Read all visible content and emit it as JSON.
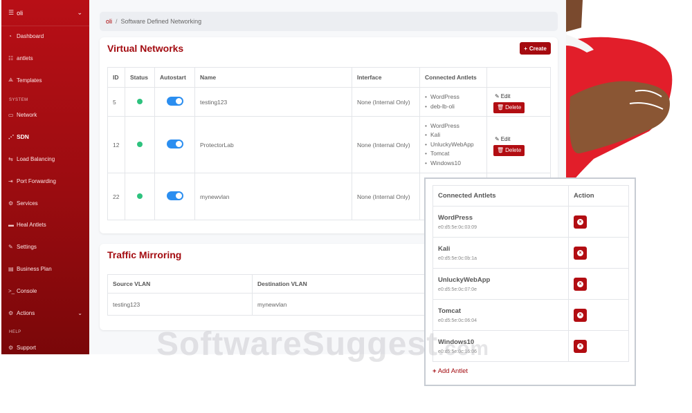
{
  "sidebar": {
    "user": "oli",
    "sections": {
      "system": "SYSTEM",
      "help": "HELP"
    },
    "items": [
      {
        "label": "Dashboard",
        "icon": "dashboard-icon"
      },
      {
        "label": "antlets",
        "icon": "list-icon"
      },
      {
        "label": "Templates",
        "icon": "templates-icon"
      },
      {
        "label": "Network",
        "icon": "network-icon"
      },
      {
        "label": "SDN",
        "icon": "sdn-icon",
        "active": true
      },
      {
        "label": "Load Balancing",
        "icon": "load-balancing-icon"
      },
      {
        "label": "Port Forwarding",
        "icon": "port-forwarding-icon"
      },
      {
        "label": "Services",
        "icon": "services-icon"
      },
      {
        "label": "Heal Antlets",
        "icon": "heal-icon"
      },
      {
        "label": "Settings",
        "icon": "settings-icon"
      },
      {
        "label": "Business Plan",
        "icon": "business-icon"
      },
      {
        "label": "Console",
        "icon": "console-icon"
      },
      {
        "label": "Actions",
        "icon": "actions-icon"
      },
      {
        "label": "Support",
        "icon": "support-icon"
      }
    ]
  },
  "breadcrumb": {
    "root": "oli",
    "current": "Software Defined Networking"
  },
  "virtual_networks": {
    "title": "Virtual Networks",
    "create_label": "Create",
    "columns": [
      "ID",
      "Status",
      "Autostart",
      "Name",
      "Interface",
      "Connected Antlets",
      ""
    ],
    "edit_label": "Edit",
    "delete_label": "Delete",
    "rows": [
      {
        "id": "5",
        "name": "testing123",
        "interface": "None (Internal Only)",
        "antlets": [
          "WordPress",
          "deb-lb-oli"
        ]
      },
      {
        "id": "12",
        "name": "ProtectorLab",
        "interface": "None (Internal Only)",
        "antlets": [
          "WordPress",
          "Kali",
          "UnluckyWebApp",
          "Tomcat",
          "Windows10"
        ]
      },
      {
        "id": "22",
        "name": "mynewvlan",
        "interface": "None (Internal Only)",
        "antlets": []
      }
    ]
  },
  "traffic_mirroring": {
    "title": "Traffic Mirroring",
    "columns": [
      "Source VLAN",
      "Destination VLAN"
    ],
    "rows": [
      {
        "source": "testing123",
        "destination": "mynewvlan"
      }
    ]
  },
  "popup": {
    "columns": [
      "Connected Antlets",
      "Action"
    ],
    "rows": [
      {
        "name": "WordPress",
        "mac": "e0:d5:5e:0c:03:09"
      },
      {
        "name": "Kali",
        "mac": "e0:d5:5e:0c:0b:1a"
      },
      {
        "name": "UnluckyWebApp",
        "mac": "e0:d5:5e:0c:07:0e"
      },
      {
        "name": "Tomcat",
        "mac": "e0:d5:5e:0c:06:04"
      },
      {
        "name": "Windows10",
        "mac": "e0:d5:5e:0c:16:06"
      }
    ],
    "add_label": "Add Antlet"
  },
  "watermark": {
    "main": "SoftwareSuggest",
    "suffix": ".com"
  },
  "colors": {
    "brand": "#a30b10",
    "sidebar": "#b80f16",
    "status_ok": "#2ec27e",
    "toggle_on": "#2b8ef0"
  }
}
